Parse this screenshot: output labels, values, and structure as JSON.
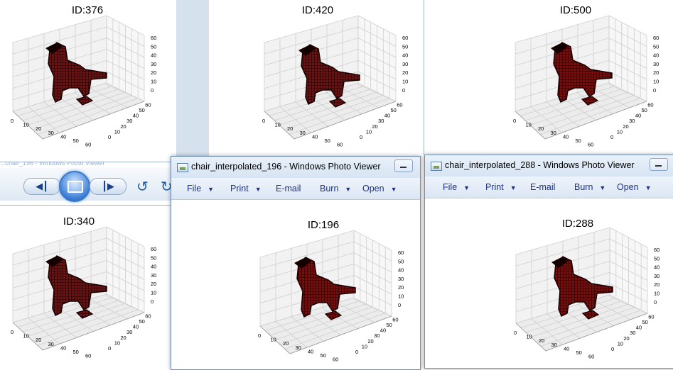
{
  "plots": {
    "p376": {
      "title": "ID:376"
    },
    "p420": {
      "title": "ID:420"
    },
    "p500": {
      "title": "ID:500"
    },
    "p340": {
      "title": "ID:340"
    },
    "p196": {
      "title": "ID:196"
    },
    "p288": {
      "title": "ID:288"
    }
  },
  "axes": {
    "z_ticks": [
      "60",
      "50",
      "40",
      "30",
      "20",
      "10",
      "0"
    ],
    "x_ticks": [
      "0",
      "10",
      "20",
      "30",
      "40",
      "50",
      "60"
    ],
    "y_ticks": [
      "0",
      "10",
      "20",
      "30",
      "40",
      "50",
      "60"
    ]
  },
  "window_196": {
    "title": "chair_interpolated_196 - Windows Photo Viewer",
    "menu": [
      "File",
      "Print",
      "E-mail",
      "Burn",
      "Open"
    ]
  },
  "window_288": {
    "title": "chair_interpolated_288 - Windows Photo Viewer",
    "menu": [
      "File",
      "Print",
      "E-mail",
      "Burn",
      "Open"
    ]
  },
  "media_player": {
    "title_fragment": "...chair_196 - Windows Photo Viewer"
  },
  "colors": {
    "voxel_fill": "#7a0c0c",
    "voxel_dark": "#150000",
    "grid": "#cfcfcf",
    "pane": "#f2f2f2"
  }
}
